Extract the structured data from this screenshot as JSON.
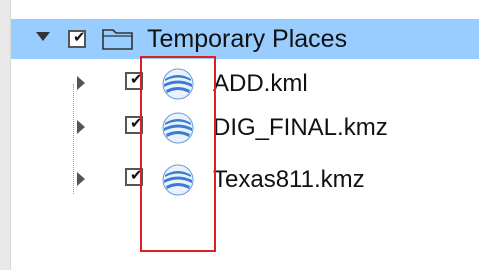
{
  "tree": {
    "root": {
      "label": "Temporary Places",
      "checked": true,
      "expanded": true,
      "icon": "folder-icon"
    },
    "children": [
      {
        "label": "ADD.kml",
        "checked": true,
        "icon": "earth-globe-icon"
      },
      {
        "label": "DIG_FINAL.kmz",
        "checked": true,
        "icon": "earth-globe-icon"
      },
      {
        "label": "Texas811.kmz",
        "checked": true,
        "icon": "earth-globe-icon"
      }
    ],
    "check_glyph": "✔"
  },
  "colors": {
    "selection": "#99ccff",
    "annotation_box": "#e02020",
    "globe_blue": "#3a7bd5"
  }
}
